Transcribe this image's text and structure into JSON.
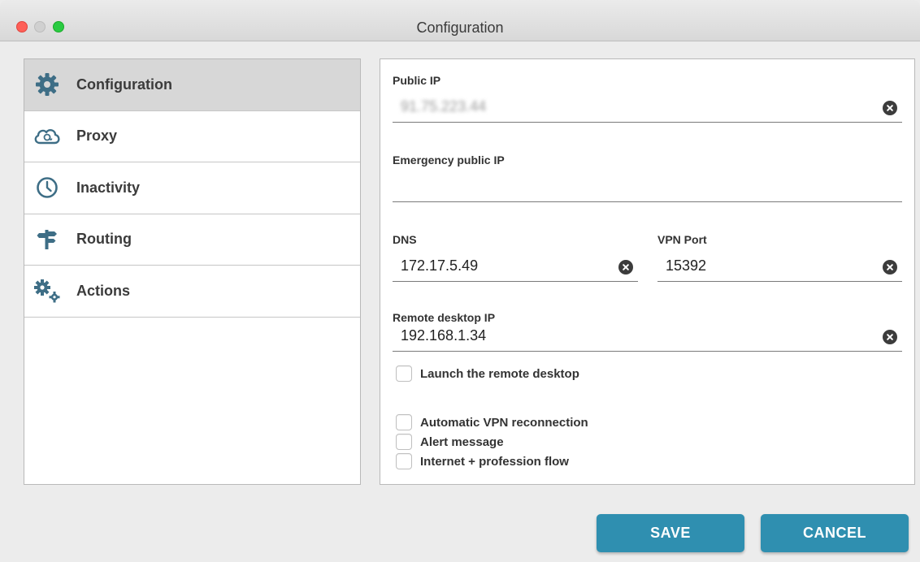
{
  "window": {
    "title": "Configuration"
  },
  "sidebar": {
    "items": [
      {
        "label": "Configuration",
        "icon": "gear-icon",
        "active": true
      },
      {
        "label": "Proxy",
        "icon": "cloud-icon"
      },
      {
        "label": "Inactivity",
        "icon": "clock-icon"
      },
      {
        "label": "Routing",
        "icon": "signpost-icon"
      },
      {
        "label": "Actions",
        "icon": "gears-icon"
      }
    ]
  },
  "form": {
    "public_ip": {
      "label": "Public IP",
      "value": "91.75.223.44"
    },
    "emergency_ip": {
      "label": "Emergency public IP",
      "value": ""
    },
    "dns": {
      "label": "DNS",
      "value": "172.17.5.49"
    },
    "vpn_port": {
      "label": "VPN Port",
      "value": "15392"
    },
    "remote_desktop_ip": {
      "label": "Remote desktop IP",
      "value": "192.168.1.34"
    },
    "launch_remote_desktop": {
      "label": "Launch the remote desktop",
      "checked": false
    },
    "auto_vpn_reconnect": {
      "label": "Automatic VPN reconnection",
      "checked": false
    },
    "alert_message": {
      "label": "Alert message",
      "checked": false
    },
    "internet_profession_flow": {
      "label": "Internet + profession flow",
      "checked": false
    }
  },
  "buttons": {
    "save": "SAVE",
    "cancel": "CANCEL"
  },
  "colors": {
    "accent": "#2f8fb0",
    "active_item": "#d7d7d7",
    "icon": "#3e6e86"
  }
}
